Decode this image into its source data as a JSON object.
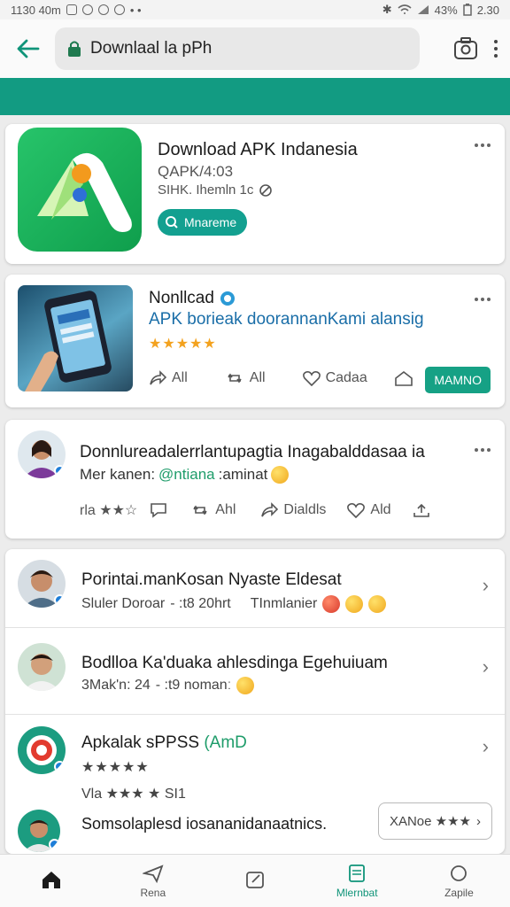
{
  "status_bar": {
    "time": "1130 40m",
    "battery": "43%",
    "clock": "2.30"
  },
  "browser": {
    "url": "Downlaal la pPh"
  },
  "card1": {
    "title": "Download APK Indanesia",
    "sub1": "QAPK/4:03",
    "sub2": "SIHK. Ihemln 1c",
    "button_label": "Mnareme"
  },
  "card2": {
    "title": "Nonllcad",
    "description": "APK borieak doorannanKami alansig",
    "stars": "★★★★★",
    "actions": [
      "All",
      "All",
      "Cadaa"
    ],
    "button_label": "MAMNO"
  },
  "card3": {
    "title": "Donnlureadalerrlantupagtia Inagabalddasaa ia",
    "sub_prefix": "Mer kanen:",
    "sub_tag": "@ntiana",
    "sub_suffix": ":aminat",
    "actions": [
      "rla ★★☆",
      "",
      "Ahl",
      "Dialdls",
      "Ald",
      ""
    ]
  },
  "list": [
    {
      "title": "Porintai.manKosan Nyaste Eldesat",
      "sub": "Sluler Doroar",
      "sub_mid": "- :t8 20hrt",
      "sub_right": "TInmlanier"
    },
    {
      "title": "Bodlloa Ka'duaka ahlesdinga Egehuiuam",
      "sub": "3Mak'n: 24",
      "sub_mid": "- :t9 nomanː",
      "sub_right": ""
    },
    {
      "title": "Apkalak sPPSS",
      "title_accent": "(AmD",
      "stars": "★★★★★",
      "sub": "Vla ★★★ ★ SI1"
    },
    {
      "title": "Somsolaplesd iosananidanaatnics.",
      "button_label": "XANoe ★★★"
    }
  ],
  "bottom_nav": [
    {
      "label": ""
    },
    {
      "label": "Rena"
    },
    {
      "label": ""
    },
    {
      "label": "Mlernbat"
    },
    {
      "label": "Zapile"
    }
  ],
  "colors": {
    "accent": "#129b82",
    "star": "#f3a21f",
    "link": "#1a6ea8"
  }
}
